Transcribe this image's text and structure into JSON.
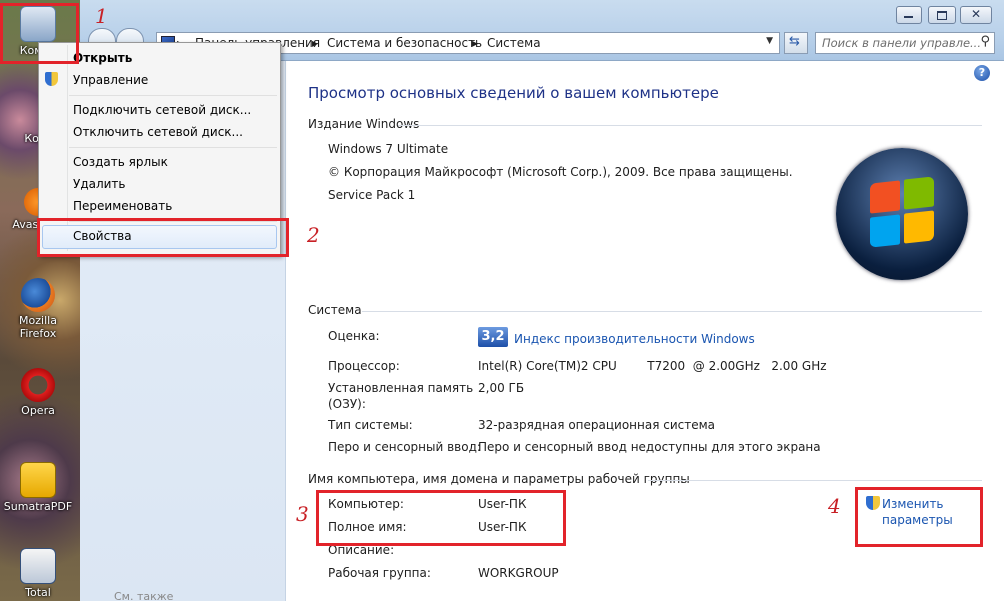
{
  "desktop": {
    "icons": [
      {
        "label": "Компь",
        "icon": "computer-icon"
      },
      {
        "label": "Корз",
        "icon": "recycle-bin-icon"
      },
      {
        "label": "Avas Anti",
        "icon": "avast-icon"
      },
      {
        "label": "Mozilla Firefox",
        "icon": "firefox-icon"
      },
      {
        "label": "Opera",
        "icon": "opera-icon"
      },
      {
        "label": "SumatraPDF",
        "icon": "sumatrapdf-icon"
      },
      {
        "label": "Total",
        "icon": "total-commander-icon"
      }
    ]
  },
  "context_menu": {
    "items": [
      "Открыть",
      "Управление",
      "Подключить сетевой диск...",
      "Отключить сетевой диск...",
      "Создать ярлык",
      "Удалить",
      "Переименовать",
      "Свойства"
    ]
  },
  "window": {
    "breadcrumbs": [
      "Панель управления",
      "Система и безопасность",
      "Система"
    ],
    "search_placeholder": "Поиск в панели управле...",
    "left_pane_footer": "См. также"
  },
  "main": {
    "heading": "Просмотр основных сведений о вашем компьютере",
    "edition": {
      "title": "Издание Windows",
      "name": "Windows 7 Ultimate",
      "copyright": "© Корпорация Майкрософт (Microsoft Corp.), 2009. Все права защищены.",
      "service_pack": "Service Pack 1"
    },
    "system": {
      "title": "Система",
      "rating_label": "Оценка:",
      "rating_score": "3,2",
      "rating_link": "Индекс производительности Windows",
      "processor_label": "Процессор:",
      "processor_value": "Intel(R) Core(TM)2 CPU        T7200  @ 2.00GHz   2.00 GHz",
      "memory_label_1": "Установленная память",
      "memory_label_2": "(ОЗУ):",
      "memory_value": "2,00 ГБ",
      "type_label": "Тип системы:",
      "type_value": "32-разрядная операционная система",
      "pen_label": "Перо и сенсорный ввод:",
      "pen_value": "Перо и сенсорный ввод недоступны для этого экрана"
    },
    "computer_name": {
      "title": "Имя компьютера, имя домена и параметры рабочей группы",
      "computer_label": "Компьютер:",
      "computer_value": "User-ПК",
      "fullname_label": "Полное имя:",
      "fullname_value": "User-ПК",
      "desc_label": "Описание:",
      "workgroup_label": "Рабочая группа:",
      "workgroup_value": "WORKGROUP",
      "change_link_1": "Изменить",
      "change_link_2": "параметры"
    }
  },
  "annotations": {
    "n1": "1",
    "n2": "2",
    "n3": "3",
    "n4": "4"
  },
  "colors": {
    "highlight": "#e2232a",
    "link": "#1a55b0",
    "heading": "#1e3287"
  }
}
